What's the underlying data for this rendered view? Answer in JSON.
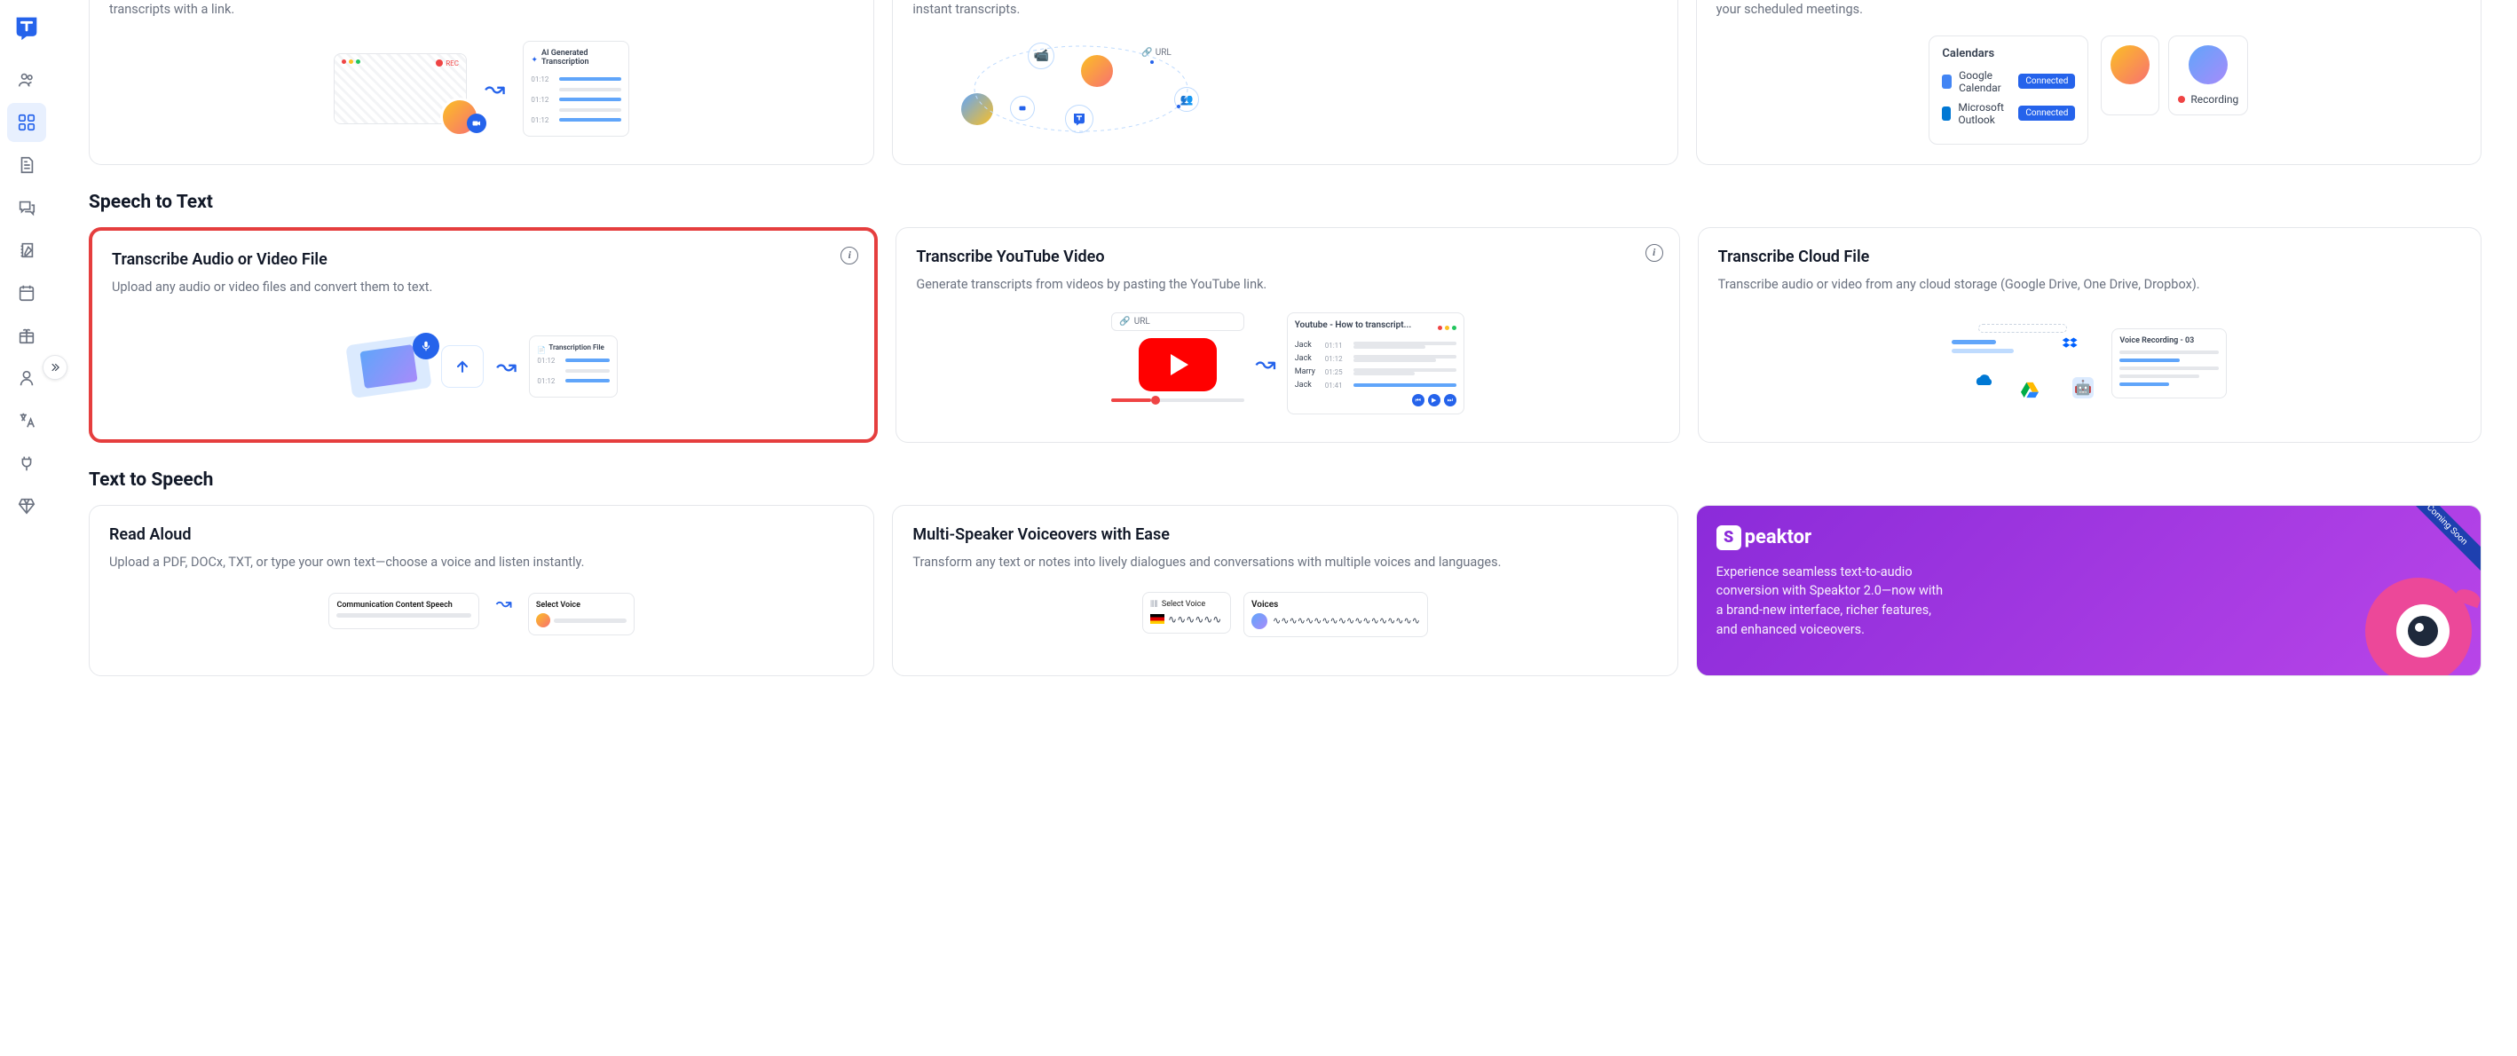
{
  "sidebar": {
    "items": [
      "team",
      "dashboard",
      "documents",
      "chat",
      "notes",
      "calendar",
      "gift",
      "profile",
      "translate",
      "integrations",
      "premium"
    ]
  },
  "top_row": {
    "cards": [
      {
        "desc_tail": "transcripts with a link.",
        "illus": {
          "ai_label": "AI Generated Transcription",
          "rec": "REC",
          "times": [
            "01:12",
            "01:12",
            "01:12"
          ]
        }
      },
      {
        "desc_tail": "instant transcripts.",
        "illus": {
          "url_label": "URL"
        }
      },
      {
        "desc_tail": "your scheduled meetings.",
        "illus": {
          "title": "Calendars",
          "google": "Google Calendar",
          "outlook": "Microsoft Outlook",
          "connected": "Connected",
          "recording": "Recording"
        }
      }
    ]
  },
  "section_speech": {
    "title": "Speech to Text"
  },
  "speech_cards": [
    {
      "title": "Transcribe Audio or Video File",
      "desc": "Upload any audio or video files and convert them to text.",
      "has_info": true,
      "illus": {
        "file_label": "Transcription File",
        "times": [
          "01:12",
          "01:12"
        ]
      }
    },
    {
      "title": "Transcribe YouTube Video",
      "desc": "Generate transcripts from videos by pasting the YouTube link.",
      "has_info": true,
      "illus": {
        "url": "URL",
        "yt_title": "Youtube - How to transcript...",
        "rows": [
          {
            "name": "Jack",
            "time": "01:11"
          },
          {
            "name": "Jack",
            "time": "01:12"
          },
          {
            "name": "Marry",
            "time": "01:25"
          },
          {
            "name": "Jack",
            "time": "01:41"
          }
        ]
      }
    },
    {
      "title": "Transcribe Cloud File",
      "desc": "Transcribe audio or video from any cloud storage (Google Drive, One Drive, Dropbox).",
      "has_info": false,
      "illus": {
        "file_label": "Voice Recording - 03"
      }
    }
  ],
  "section_tts": {
    "title": "Text to Speech"
  },
  "tts_cards": [
    {
      "title": "Read Aloud",
      "desc": "Upload a PDF, DOCx, TXT, or type your own text—choose a voice and listen instantly.",
      "illus": {
        "panel1": "Communication Content Speech",
        "panel2": "Select Voice"
      }
    },
    {
      "title": "Multi-Speaker Voiceovers with Ease",
      "desc": "Transform any text or notes into lively dialogues and conversations with multiple voices and languages.",
      "illus": {
        "select": "Select Voice",
        "voices": "Voices"
      }
    },
    {
      "type": "speaktor",
      "brand": "peaktor",
      "desc": "Experience seamless text-to-audio conversion with Speaktor 2.0—now with a brand-new interface, richer features, and enhanced voiceovers.",
      "badge": "Coming Soon"
    }
  ]
}
